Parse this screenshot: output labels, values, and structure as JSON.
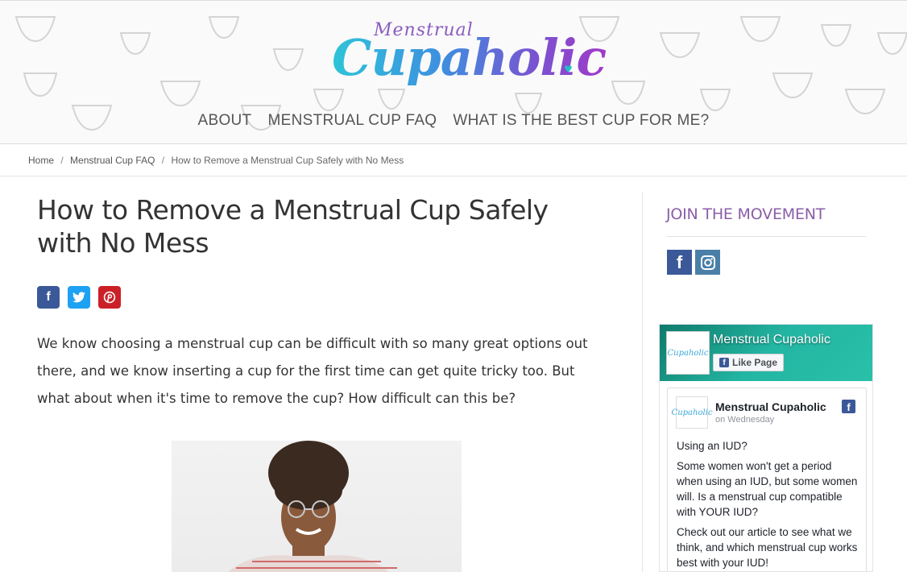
{
  "header": {
    "logo_small": "Menstrual",
    "logo_big": "Cupaholic",
    "nav": [
      {
        "label": "ABOUT"
      },
      {
        "label": "MENSTRUAL CUP FAQ"
      },
      {
        "label": "WHAT IS THE BEST CUP FOR ME?"
      }
    ]
  },
  "breadcrumb": {
    "items": [
      "Home",
      "Menstrual Cup FAQ",
      "How to Remove a Menstrual Cup Safely with No Mess"
    ],
    "separator": "/"
  },
  "article": {
    "title": "How to Remove a Menstrual Cup Safely with No Mess",
    "share": {
      "facebook": "f",
      "twitter": "t",
      "pinterest": "p"
    },
    "intro": "We know choosing a menstrual cup can be difficult with so many great options out there, and we know inserting a cup for the first time can get quite tricky too. But what about when it's time to remove the cup? How difficult can this be?"
  },
  "sidebar": {
    "heading": "JOIN THE MOVEMENT",
    "social_facebook": "f",
    "facebook_widget": {
      "page_name": "Menstrual Cupaholic",
      "like_label": "Like Page",
      "post": {
        "author": "Menstrual Cupaholic",
        "date": "on Wednesday",
        "p1": "Using an IUD?",
        "p2": "Some women won't get a period when using an IUD, but some women will. Is a menstrual cup compatible with YOUR IUD?",
        "p3": "Check out our article to see what we think, and which menstrual cup works best with your IUD!"
      }
    }
  },
  "colors": {
    "accent_purple": "#8b5ea8",
    "facebook_blue": "#3b5998",
    "twitter_blue": "#1da1f2",
    "pinterest_red": "#cb2027"
  }
}
